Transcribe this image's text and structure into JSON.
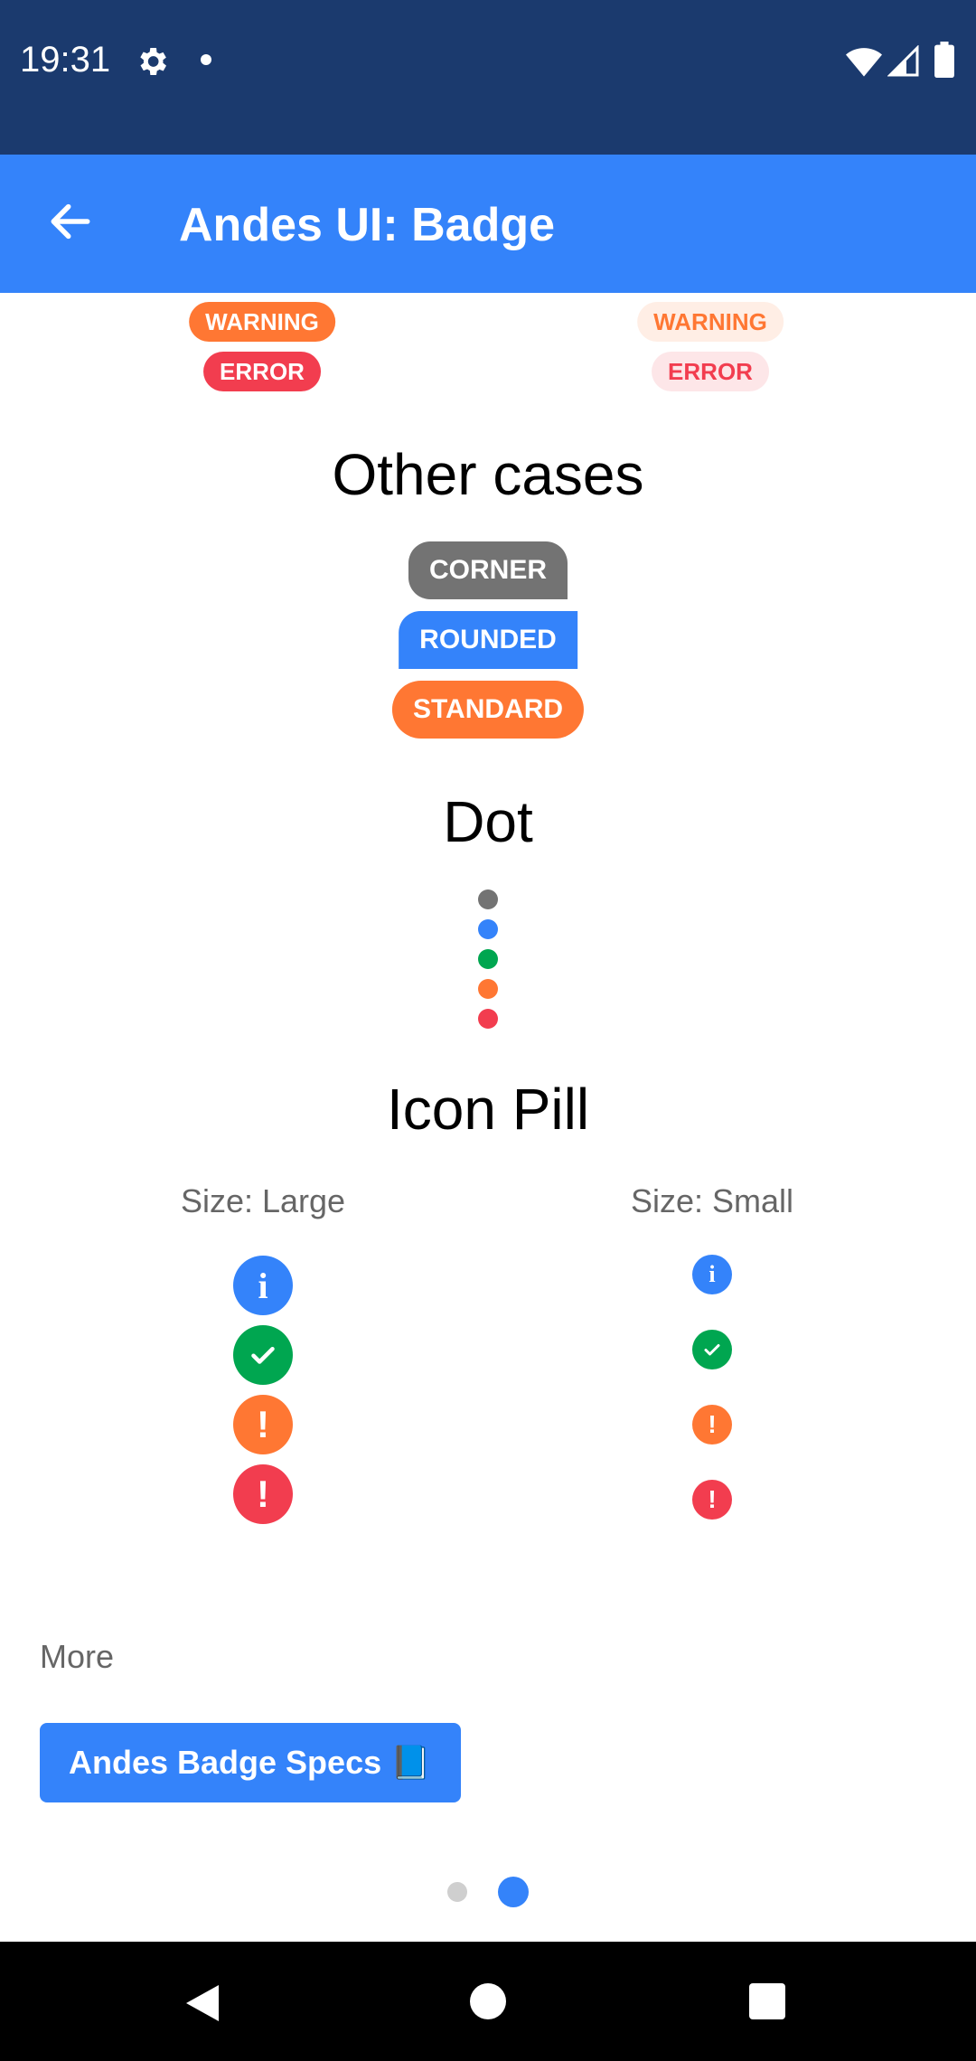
{
  "status_bar": {
    "time": "19:31"
  },
  "app_bar": {
    "title": "Andes UI: Badge"
  },
  "top_badges": {
    "left": {
      "warning": "WARNING",
      "error": "ERROR"
    },
    "right": {
      "warning": "WARNING",
      "error": "ERROR"
    }
  },
  "other_cases": {
    "heading": "Other cases",
    "badges": [
      "CORNER",
      "ROUNDED",
      "STANDARD"
    ]
  },
  "dot_section": {
    "heading": "Dot"
  },
  "icon_pill": {
    "heading": "Icon Pill",
    "large_label": "Size: Large",
    "small_label": "Size: Small"
  },
  "more": {
    "label": "More",
    "button": "Andes Badge Specs 📘"
  },
  "colors": {
    "status_bar": "#1b3a6e",
    "app_bar": "#3483fa",
    "neutral": "#737373",
    "accent": "#3483fa",
    "success": "#00a650",
    "warning": "#ff7733",
    "error": "#f23d4f"
  },
  "pager": {
    "total": 2,
    "current": 2
  }
}
